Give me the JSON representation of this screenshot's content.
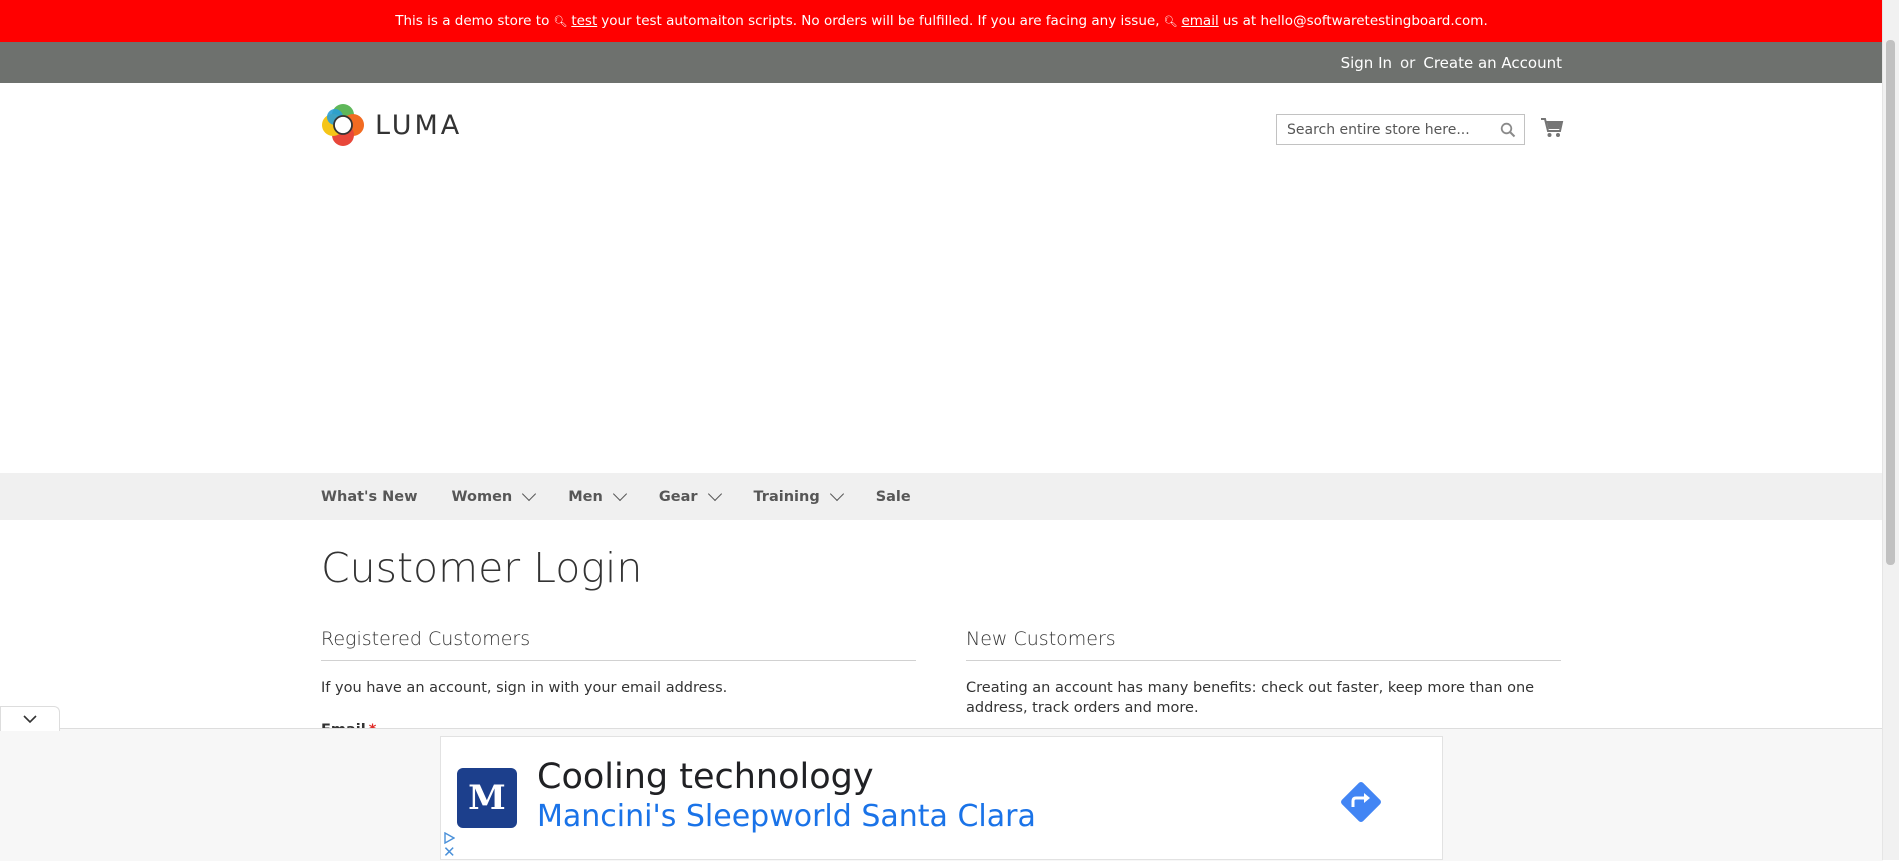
{
  "demo_notice": {
    "text_before": "This is a demo store to",
    "link_test": "test",
    "text_middle": "your test automaiton scripts. No orders will be fulfilled. If you are facing any issue,",
    "link_email": "email",
    "text_after": "us at hello@softwaretestingboard.com."
  },
  "account_bar": {
    "sign_in": "Sign In",
    "or": "or",
    "create_account": "Create an Account"
  },
  "header": {
    "logo_text": "LUMA",
    "search_placeholder": "Search entire store here..."
  },
  "nav": {
    "items": [
      {
        "label": "What's New"
      },
      {
        "label": "Women"
      },
      {
        "label": "Men"
      },
      {
        "label": "Gear"
      },
      {
        "label": "Training"
      },
      {
        "label": "Sale"
      }
    ]
  },
  "page": {
    "title": "Customer Login",
    "registered": {
      "title": "Registered Customers",
      "text": "If you have an account, sign in with your email address.",
      "email_label": "Email",
      "required_mark": "*"
    },
    "new_customers": {
      "title": "New Customers",
      "text": "Creating an account has many benefits: check out faster, keep more than one address, track orders and more."
    }
  },
  "ad": {
    "logo_letter": "M",
    "headline": "Cooling technology",
    "advertiser": "Mancini's Sleepworld Santa Clara",
    "close_glyph": "✕"
  },
  "colors": {
    "demo_bar": "#ff0000",
    "account_bar": "#6e716e",
    "nav_bg": "#f0f0f0",
    "ad_link": "#1a73e8",
    "ad_logo_bg": "#1c3f8c"
  }
}
